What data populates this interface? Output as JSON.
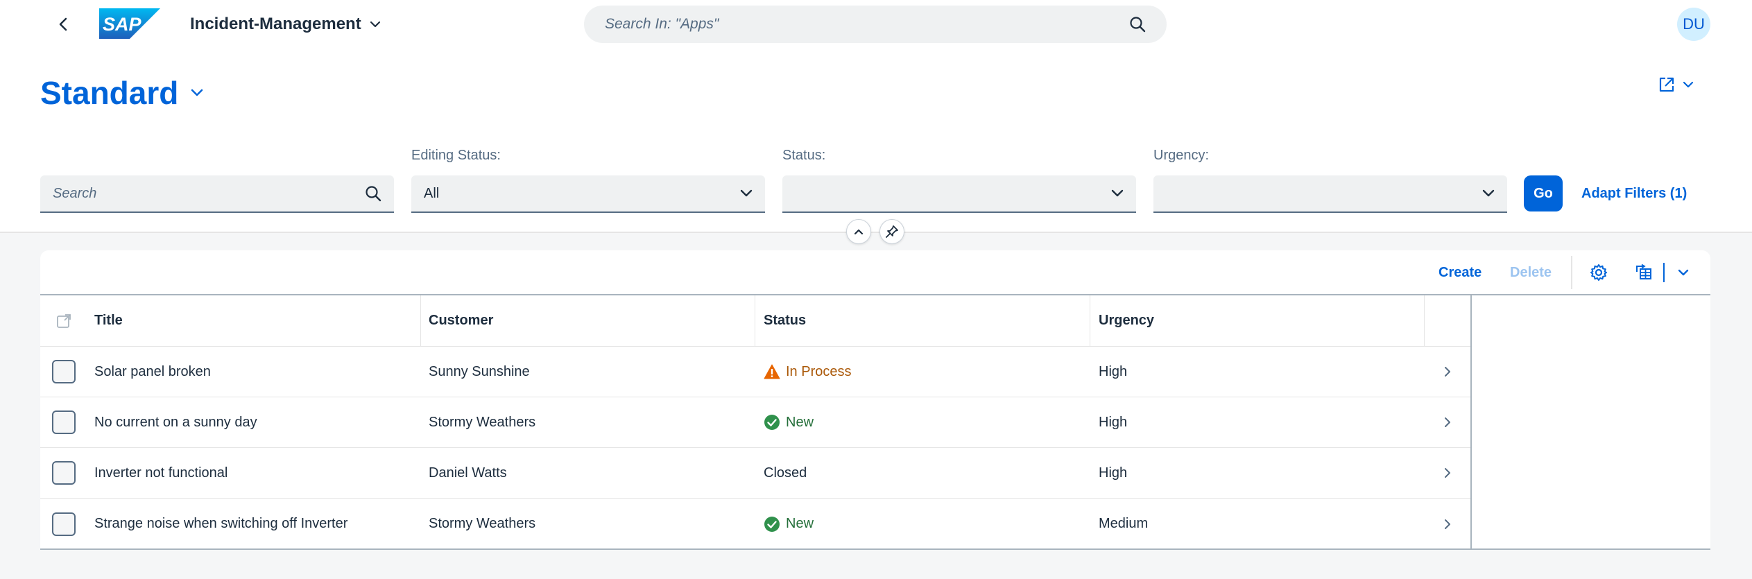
{
  "shell": {
    "app_title": "Incident-Management",
    "search_placeholder": "Search In: \"Apps\"",
    "avatar_initials": "DU",
    "logo_text": "SAP"
  },
  "header": {
    "variant_title": "Standard",
    "filters": {
      "search_placeholder": "Search",
      "editing_status_label": "Editing Status:",
      "editing_status_value": "All",
      "status_label": "Status:",
      "status_value": "",
      "urgency_label": "Urgency:",
      "urgency_value": ""
    },
    "go_label": "Go",
    "adapt_filters_label": "Adapt Filters (1)"
  },
  "toolbar": {
    "create_label": "Create",
    "delete_label": "Delete"
  },
  "table": {
    "columns": [
      "Title",
      "Customer",
      "Status",
      "Urgency"
    ],
    "rows": [
      {
        "title": "Solar panel broken",
        "customer": "Sunny Sunshine",
        "status": "In Process",
        "status_icon": "warning-icon",
        "urgency": "High"
      },
      {
        "title": "No current on a sunny day",
        "customer": "Stormy Weathers",
        "status": "New",
        "status_icon": "success-icon",
        "urgency": "High"
      },
      {
        "title": "Inverter not functional",
        "customer": "Daniel Watts",
        "status": "Closed",
        "status_icon": "",
        "urgency": "High"
      },
      {
        "title": "Strange noise when switching off Inverter",
        "customer": "Stormy Weathers",
        "status": "New",
        "status_icon": "success-icon",
        "urgency": "Medium"
      }
    ]
  },
  "colors": {
    "brand": "#0064d9",
    "warning": "#e76500",
    "success": "#30914c",
    "text": "#1d2d3e"
  }
}
